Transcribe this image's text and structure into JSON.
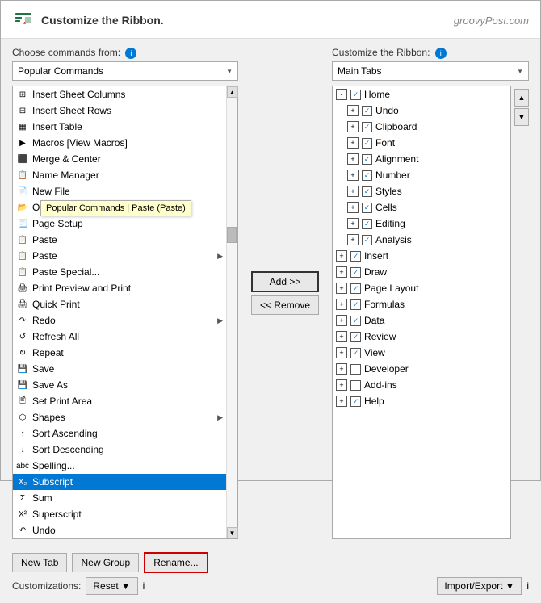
{
  "dialog": {
    "title": "Customize the Ribbon.",
    "watermark": "groovyPost.com"
  },
  "left": {
    "label": "Choose commands from:",
    "dropdown_value": "Popular Commands",
    "items": [
      {
        "icon": "insert-col",
        "label": "Insert Sheet Columns",
        "has_arrow": false
      },
      {
        "icon": "insert-row",
        "label": "Insert Sheet Rows",
        "has_arrow": false
      },
      {
        "icon": "insert-table",
        "label": "Insert Table",
        "has_arrow": false
      },
      {
        "icon": "macro",
        "label": "Macros [View Macros]",
        "has_arrow": false
      },
      {
        "icon": "merge",
        "label": "Merge & Center",
        "has_arrow": false
      },
      {
        "icon": "name-manager",
        "label": "Name Manager",
        "has_arrow": false
      },
      {
        "icon": "new-file",
        "label": "New File",
        "has_arrow": false
      },
      {
        "icon": "open",
        "label": "Open",
        "has_arrow": false
      },
      {
        "icon": "page-setup",
        "label": "Page Setup",
        "has_arrow": false
      },
      {
        "icon": "paste",
        "label": "Paste",
        "has_arrow": false
      },
      {
        "icon": "paste2",
        "label": "Paste",
        "has_arrow": true
      },
      {
        "icon": "paste3",
        "label": "Paste Special...",
        "has_arrow": false,
        "tooltip": true
      },
      {
        "icon": "print-preview",
        "label": "Print Preview and Print",
        "has_arrow": false
      },
      {
        "icon": "quick-print",
        "label": "Quick Print",
        "has_arrow": false
      },
      {
        "icon": "redo",
        "label": "Redo",
        "has_arrow": true
      },
      {
        "icon": "refresh",
        "label": "Refresh All",
        "has_arrow": false
      },
      {
        "icon": "repeat",
        "label": "Repeat",
        "has_arrow": false
      },
      {
        "icon": "save",
        "label": "Save",
        "has_arrow": false
      },
      {
        "icon": "save-as",
        "label": "Save As",
        "has_arrow": false
      },
      {
        "icon": "set-print-area",
        "label": "Set Print Area",
        "has_arrow": false
      },
      {
        "icon": "shapes",
        "label": "Shapes",
        "has_arrow": true
      },
      {
        "icon": "sort-asc",
        "label": "Sort Ascending",
        "has_arrow": false
      },
      {
        "icon": "sort-desc",
        "label": "Sort Descending",
        "has_arrow": false
      },
      {
        "icon": "spelling",
        "label": "Spelling...",
        "has_arrow": false
      },
      {
        "icon": "subscript",
        "label": "Subscript",
        "has_arrow": false,
        "selected": true
      },
      {
        "icon": "sum",
        "label": "Sum",
        "has_arrow": false
      },
      {
        "icon": "superscript",
        "label": "Superscript",
        "has_arrow": false
      },
      {
        "icon": "undo",
        "label": "Undo",
        "has_arrow": false
      }
    ],
    "tooltip_text": "Popular Commands | Paste (Paste)"
  },
  "buttons": {
    "add_label": "Add >>",
    "remove_label": "<< Remove"
  },
  "right": {
    "label": "Customize the Ribbon:",
    "dropdown_value": "Main Tabs",
    "items": [
      {
        "level": 0,
        "expand": "-",
        "checkbox": "checked",
        "label": "Home"
      },
      {
        "level": 1,
        "expand": "+",
        "checkbox": "checked",
        "label": "Undo"
      },
      {
        "level": 1,
        "expand": "+",
        "checkbox": "checked",
        "label": "Clipboard"
      },
      {
        "level": 1,
        "expand": "+",
        "checkbox": "checked",
        "label": "Font"
      },
      {
        "level": 1,
        "expand": "+",
        "checkbox": "checked",
        "label": "Alignment"
      },
      {
        "level": 1,
        "expand": "+",
        "checkbox": "checked",
        "label": "Number"
      },
      {
        "level": 1,
        "expand": "+",
        "checkbox": "checked",
        "label": "Styles"
      },
      {
        "level": 1,
        "expand": "+",
        "checkbox": "checked",
        "label": "Cells"
      },
      {
        "level": 1,
        "expand": "+",
        "checkbox": "checked",
        "label": "Editing"
      },
      {
        "level": 1,
        "expand": "+",
        "checkbox": "checked",
        "label": "Analysis"
      },
      {
        "level": 0,
        "expand": "+",
        "checkbox": "checked",
        "label": "Insert"
      },
      {
        "level": 0,
        "expand": "+",
        "checkbox": "checked",
        "label": "Draw"
      },
      {
        "level": 0,
        "expand": "+",
        "checkbox": "checked",
        "label": "Page Layout"
      },
      {
        "level": 0,
        "expand": "+",
        "checkbox": "checked",
        "label": "Formulas"
      },
      {
        "level": 0,
        "expand": "+",
        "checkbox": "checked",
        "label": "Data"
      },
      {
        "level": 0,
        "expand": "+",
        "checkbox": "checked",
        "label": "Review"
      },
      {
        "level": 0,
        "expand": "+",
        "checkbox": "checked",
        "label": "View"
      },
      {
        "level": 0,
        "expand": "+",
        "checkbox": "unchecked",
        "label": "Developer"
      },
      {
        "level": 0,
        "expand": "+",
        "checkbox": "unchecked",
        "label": "Add-ins"
      },
      {
        "level": 0,
        "expand": "+",
        "checkbox": "checked",
        "label": "Help"
      }
    ]
  },
  "footer": {
    "bottom_buttons": {
      "new_tab": "New Tab",
      "new_group": "New Group",
      "rename": "Rename..."
    },
    "customizations": "Customizations:",
    "reset": "Reset",
    "import_export": "Import/Export"
  }
}
